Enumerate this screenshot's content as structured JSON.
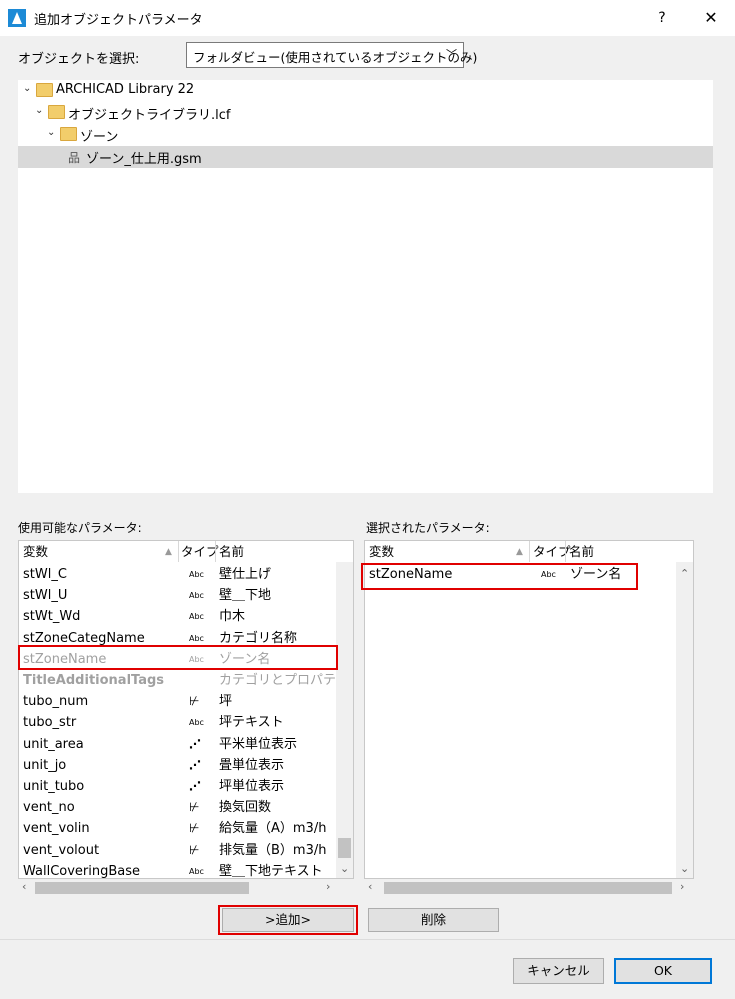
{
  "window": {
    "title": "追加オブジェクトパラメータ",
    "help": "?",
    "close": "✕"
  },
  "selector": {
    "label": "オブジェクトを選択:",
    "value": "フォルダビュー(使用されているオブジェクトのみ)"
  },
  "tree": {
    "items": [
      {
        "label": "ARCHICAD Library 22"
      },
      {
        "label": "オブジェクトライブラリ.lcf"
      },
      {
        "label": "ゾーン"
      },
      {
        "label": "ゾーン_仕上用.gsm"
      }
    ]
  },
  "available": {
    "label": "使用可能なパラメータ:",
    "col_var": "変数",
    "col_type": "タイプ",
    "col_name": "名前",
    "rows": [
      {
        "var": "stWl_C",
        "type": "Abc",
        "name": "壁仕上げ"
      },
      {
        "var": "stWl_U",
        "type": "Abc",
        "name": "壁＿下地"
      },
      {
        "var": "stWt_Wd",
        "type": "Abc",
        "name": "巾木"
      },
      {
        "var": "stZoneCategName",
        "type": "Abc",
        "name": "カテゴリ名称"
      },
      {
        "var": "stZoneName",
        "type": "Abc",
        "name": "ゾーン名"
      },
      {
        "var": "TitleAdditionalTags",
        "type": "",
        "name": "カテゴリとプロパティ"
      },
      {
        "var": "tubo_num",
        "type": "num",
        "name": "坪"
      },
      {
        "var": "tubo_str",
        "type": "Abc",
        "name": "坪テキスト"
      },
      {
        "var": "unit_area",
        "type": "list",
        "name": "平米単位表示"
      },
      {
        "var": "unit_jo",
        "type": "list",
        "name": "畳単位表示"
      },
      {
        "var": "unit_tubo",
        "type": "list",
        "name": "坪単位表示"
      },
      {
        "var": "vent_no",
        "type": "num",
        "name": "換気回数"
      },
      {
        "var": "vent_volin",
        "type": "num",
        "name": "給気量（A）m3/h"
      },
      {
        "var": "vent_volout",
        "type": "num",
        "name": "排気量（B）m3/h"
      },
      {
        "var": "WallCoveringBase",
        "type": "Abc",
        "name": "壁＿下地テキスト"
      }
    ]
  },
  "selected": {
    "label": "選択されたパラメータ:",
    "col_var": "変数",
    "col_type": "タイプ",
    "col_name": "名前",
    "rows": [
      {
        "var": "stZoneName",
        "type": "Abc",
        "name": "ゾーン名"
      }
    ]
  },
  "buttons": {
    "add": ">追加>",
    "remove": "削除",
    "cancel": "キャンセル",
    "ok": "OK"
  },
  "colors": {
    "highlight": "#e00000",
    "accent": "#0078d7",
    "folder": "#f2cd6b"
  }
}
